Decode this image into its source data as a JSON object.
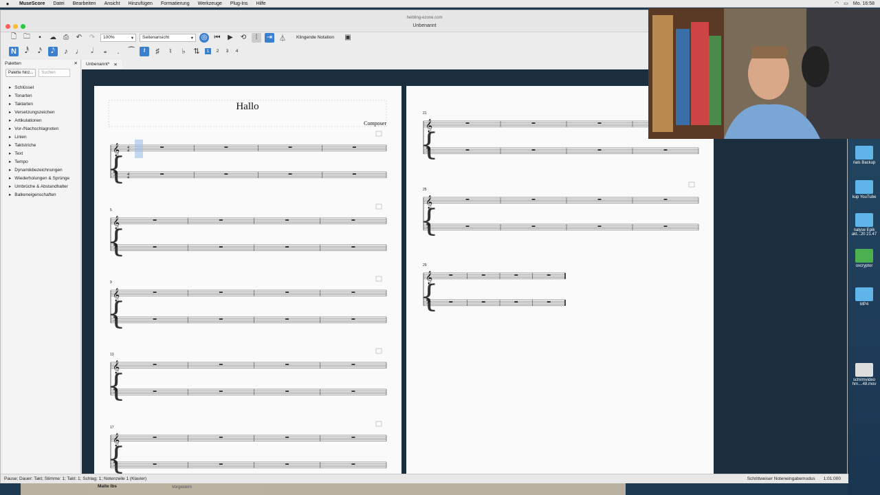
{
  "menubar": {
    "app": "MuseScore",
    "items": [
      "Datei",
      "Bearbeiten",
      "Ansicht",
      "Hinzufügen",
      "Formatierung",
      "Werkzeuge",
      "Plug-Ins",
      "Hilfe"
    ],
    "clock": "Mo. 16:58"
  },
  "window": {
    "url": "heibling-ezone.com",
    "title": "Unbenannt"
  },
  "toolbar": {
    "zoom": "100%",
    "view_mode": "Seitenansicht",
    "concert_pitch": "Klingende Notation"
  },
  "notes": {
    "voices": [
      "1",
      "2",
      "3",
      "4"
    ]
  },
  "palettes": {
    "title": "Paletten",
    "add_button": "Palette hinz...",
    "search_placeholder": "Suchen",
    "items": [
      "Schlüssel",
      "Tonarten",
      "Taktarten",
      "Versetzungszeichen",
      "Artikulationen",
      "Vor-/Nachschlagnoten",
      "Linien",
      "Taktstriche",
      "Text",
      "Tempo",
      "Dynamikbezeichnungen",
      "Wiederholungen & Sprünge",
      "Umbrüche & Abstandhalter",
      "Balkeneigenschaften"
    ]
  },
  "tab": {
    "label": "Unbenannt*"
  },
  "score": {
    "title": "Hallo",
    "composer": "Composer",
    "time_sig": "4",
    "page1_systems": [
      "",
      "5",
      "9",
      "13",
      "17"
    ],
    "page2_systems": [
      "21",
      "25",
      "29"
    ]
  },
  "status": {
    "left": "Pause; Dauer: Takt; Stimme: 1; Takt: 1; Schlag: 1; Notenzeile 1 (Klavier)",
    "mode": "Schrittweiser Noteneingabemodus",
    "position": "1:01:000"
  },
  "desktop": {
    "icons": [
      "rials Backup",
      "kup YouTube",
      "nalyse Epik\nakt...20 21.47",
      "oxcryptor",
      "MP4",
      "schirmvideo\nhm....48.mov"
    ]
  },
  "dock": {
    "labels": [
      "Malte Ibs",
      "Vorgestern"
    ]
  }
}
